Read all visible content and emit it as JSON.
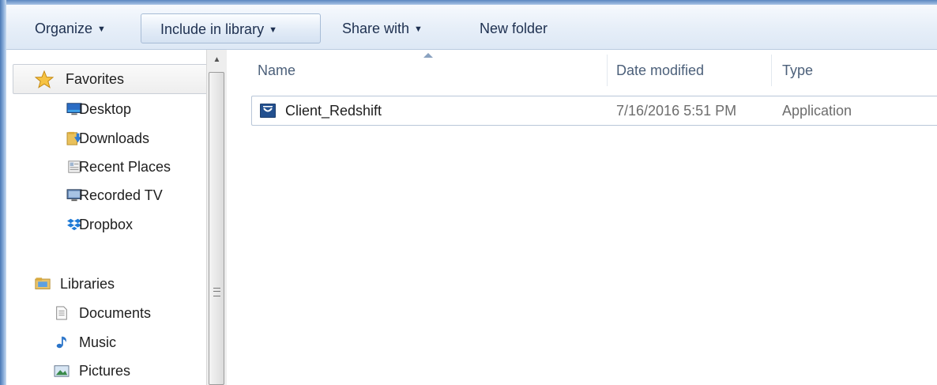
{
  "toolbar": {
    "organize": "Organize",
    "include_in_library": "Include in library",
    "share_with": "Share with",
    "new_folder": "New folder"
  },
  "nav": {
    "favorites": "Favorites",
    "favorites_items": [
      {
        "label": "Desktop",
        "icon": "desktop-icon"
      },
      {
        "label": "Downloads",
        "icon": "downloads-icon"
      },
      {
        "label": "Recent Places",
        "icon": "recent-places-icon"
      },
      {
        "label": "Recorded TV",
        "icon": "recorded-tv-icon"
      },
      {
        "label": "Dropbox",
        "icon": "dropbox-icon"
      }
    ],
    "libraries": "Libraries",
    "libraries_items": [
      {
        "label": "Documents",
        "icon": "document-icon"
      },
      {
        "label": "Music",
        "icon": "music-icon"
      },
      {
        "label": "Pictures",
        "icon": "pictures-icon"
      }
    ]
  },
  "columns": {
    "name": "Name",
    "date_modified": "Date modified",
    "type": "Type"
  },
  "files": [
    {
      "name": "Client_Redshift",
      "date_modified": "7/16/2016 5:51 PM",
      "type": "Application",
      "icon": "application-icon"
    }
  ],
  "colors": {
    "accent": "#23508f",
    "toolbar_bg": "#e6eef8",
    "header_text": "#4c607a"
  }
}
